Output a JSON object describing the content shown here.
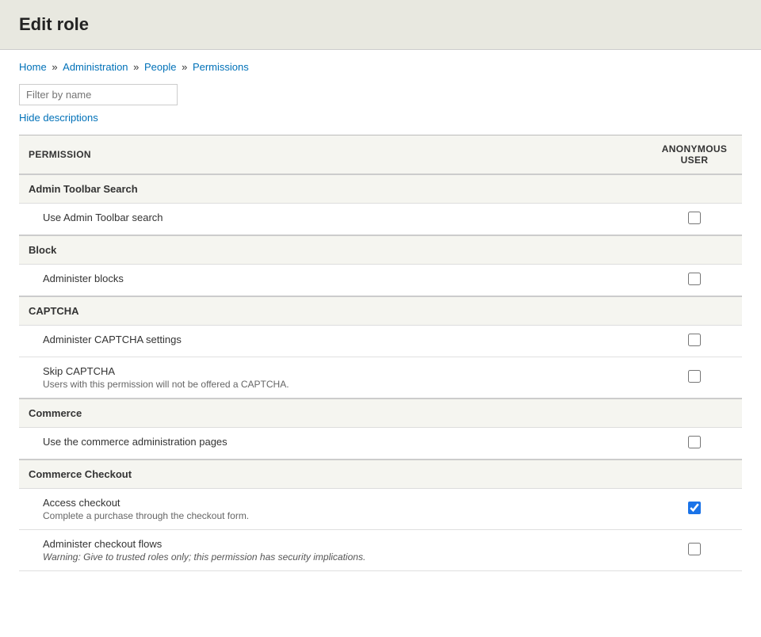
{
  "page": {
    "title": "Edit role",
    "breadcrumb": [
      {
        "label": "Home",
        "url": "#"
      },
      {
        "label": "Administration",
        "url": "#"
      },
      {
        "label": "People",
        "url": "#"
      },
      {
        "label": "Permissions",
        "url": "#"
      }
    ]
  },
  "filter": {
    "placeholder": "Filter by name"
  },
  "hide_descriptions_label": "Hide descriptions",
  "table": {
    "col_permission": "PERMISSION",
    "col_anon_line1": "ANONYMOUS",
    "col_anon_line2": "USER"
  },
  "groups": [
    {
      "name": "Admin Toolbar Search",
      "permissions": [
        {
          "name": "Use Admin Toolbar search",
          "description": "",
          "checked": false
        }
      ]
    },
    {
      "name": "Block",
      "permissions": [
        {
          "name": "Administer blocks",
          "description": "",
          "checked": false
        }
      ]
    },
    {
      "name": "CAPTCHA",
      "permissions": [
        {
          "name": "Administer CAPTCHA settings",
          "description": "",
          "checked": false
        },
        {
          "name": "Skip CAPTCHA",
          "description": "Users with this permission will not be offered a CAPTCHA.",
          "description_class": "",
          "checked": false
        }
      ]
    },
    {
      "name": "Commerce",
      "permissions": [
        {
          "name": "Use the commerce administration pages",
          "description": "",
          "checked": false
        }
      ]
    },
    {
      "name": "Commerce Checkout",
      "permissions": [
        {
          "name": "Access checkout",
          "description": "Complete a purchase through the checkout form.",
          "description_class": "",
          "checked": true
        },
        {
          "name": "Administer checkout flows",
          "description": "Warning: Give to trusted roles only; this permission has security implications.",
          "description_class": "warning",
          "checked": false
        }
      ]
    }
  ]
}
